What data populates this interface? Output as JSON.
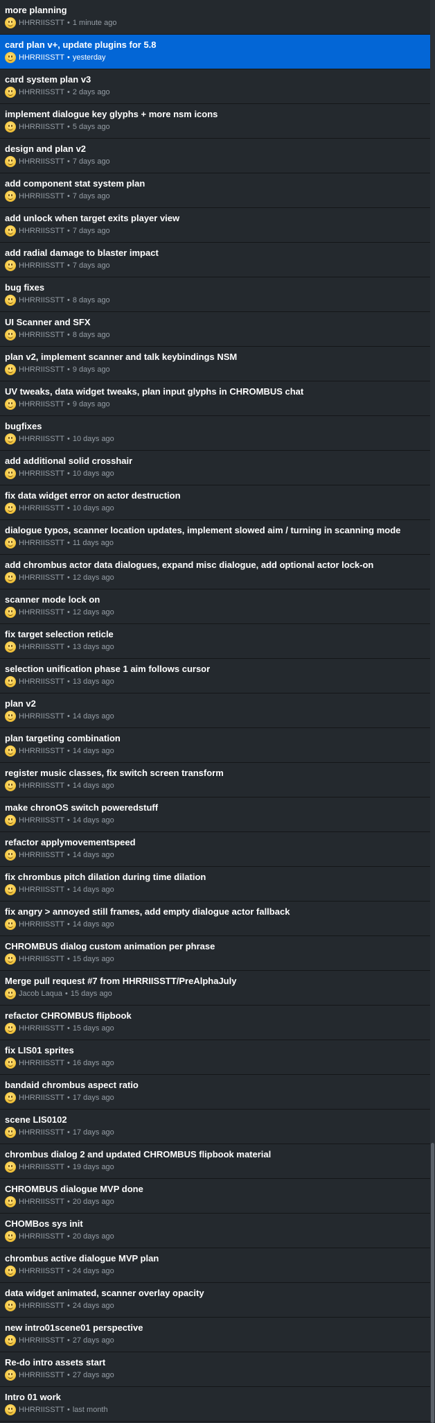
{
  "commits": [
    {
      "summary": "more planning",
      "author": "HHRRIISSTT",
      "time": "1 minute ago"
    },
    {
      "summary": "card plan v+, update plugins for 5.8",
      "author": "HHRRIISSTT",
      "time": "yesterday",
      "selected": true
    },
    {
      "summary": "card system plan v3",
      "author": "HHRRIISSTT",
      "time": "2 days ago"
    },
    {
      "summary": "implement dialogue key glyphs + more nsm icons",
      "author": "HHRRIISSTT",
      "time": "5 days ago"
    },
    {
      "summary": "design and plan v2",
      "author": "HHRRIISSTT",
      "time": "7 days ago"
    },
    {
      "summary": "add component stat system plan",
      "author": "HHRRIISSTT",
      "time": "7 days ago"
    },
    {
      "summary": "add unlock when target exits player view",
      "author": "HHRRIISSTT",
      "time": "7 days ago"
    },
    {
      "summary": "add radial damage to blaster impact",
      "author": "HHRRIISSTT",
      "time": "7 days ago"
    },
    {
      "summary": "bug fixes",
      "author": "HHRRIISSTT",
      "time": "8 days ago"
    },
    {
      "summary": "UI Scanner and SFX",
      "author": "HHRRIISSTT",
      "time": "8 days ago"
    },
    {
      "summary": "plan v2, implement scanner and talk keybindings NSM",
      "author": "HHRRIISSTT",
      "time": "9 days ago"
    },
    {
      "summary": "UV tweaks, data widget tweaks, plan input glyphs in CHROMBUS chat",
      "author": "HHRRIISSTT",
      "time": "9 days ago"
    },
    {
      "summary": "bugfixes",
      "author": "HHRRIISSTT",
      "time": "10 days ago"
    },
    {
      "summary": "add additional solid crosshair",
      "author": "HHRRIISSTT",
      "time": "10 days ago"
    },
    {
      "summary": "fix data widget error on actor destruction",
      "author": "HHRRIISSTT",
      "time": "10 days ago"
    },
    {
      "summary": "dialogue typos, scanner location updates, implement slowed aim / turning in scanning mode",
      "author": "HHRRIISSTT",
      "time": "11 days ago"
    },
    {
      "summary": "add chrombus actor data dialogues, expand misc dialogue, add optional actor lock-on",
      "author": "HHRRIISSTT",
      "time": "12 days ago"
    },
    {
      "summary": "scanner mode lock on",
      "author": "HHRRIISSTT",
      "time": "12 days ago"
    },
    {
      "summary": "fix target selection reticle",
      "author": "HHRRIISSTT",
      "time": "13 days ago"
    },
    {
      "summary": "selection unification phase 1 aim follows cursor",
      "author": "HHRRIISSTT",
      "time": "13 days ago"
    },
    {
      "summary": "plan v2",
      "author": "HHRRIISSTT",
      "time": "14 days ago"
    },
    {
      "summary": "plan targeting combination",
      "author": "HHRRIISSTT",
      "time": "14 days ago"
    },
    {
      "summary": "register music classes, fix switch screen transform",
      "author": "HHRRIISSTT",
      "time": "14 days ago"
    },
    {
      "summary": "make chronOS switch poweredstuff",
      "author": "HHRRIISSTT",
      "time": "14 days ago"
    },
    {
      "summary": "refactor applymovementspeed",
      "author": "HHRRIISSTT",
      "time": "14 days ago"
    },
    {
      "summary": "fix chrombus pitch dilation during time dilation",
      "author": "HHRRIISSTT",
      "time": "14 days ago"
    },
    {
      "summary": "fix angry > annoyed still frames, add empty dialogue actor fallback",
      "author": "HHRRIISSTT",
      "time": "14 days ago"
    },
    {
      "summary": "CHROMBUS dialog custom animation per phrase",
      "author": "HHRRIISSTT",
      "time": "15 days ago"
    },
    {
      "summary": "Merge pull request #7 from HHRRIISSTT/PreAlphaJuly",
      "author": "Jacob Laqua",
      "time": "15 days ago"
    },
    {
      "summary": "refactor CHROMBUS flipbook",
      "author": "HHRRIISSTT",
      "time": "15 days ago"
    },
    {
      "summary": "fix LIS01 sprites",
      "author": "HHRRIISSTT",
      "time": "16 days ago"
    },
    {
      "summary": "bandaid chrombus aspect ratio",
      "author": "HHRRIISSTT",
      "time": "17 days ago"
    },
    {
      "summary": "scene LIS0102",
      "author": "HHRRIISSTT",
      "time": "17 days ago"
    },
    {
      "summary": "chrombus dialog 2 and updated CHROMBUS flipbook material",
      "author": "HHRRIISSTT",
      "time": "19 days ago"
    },
    {
      "summary": "CHROMBUS dialogue MVP done",
      "author": "HHRRIISSTT",
      "time": "20 days ago"
    },
    {
      "summary": "CHOMBos sys init",
      "author": "HHRRIISSTT",
      "time": "20 days ago"
    },
    {
      "summary": "chrombus active dialogue MVP plan",
      "author": "HHRRIISSTT",
      "time": "24 days ago"
    },
    {
      "summary": "data widget animated, scanner overlay opacity",
      "author": "HHRRIISSTT",
      "time": "24 days ago"
    },
    {
      "summary": "new intro01scene01 perspective",
      "author": "HHRRIISSTT",
      "time": "27 days ago"
    },
    {
      "summary": "Re-do intro assets start",
      "author": "HHRRIISSTT",
      "time": "27 days ago"
    },
    {
      "summary": "Intro 01 work",
      "author": "HHRRIISSTT",
      "time": "last month"
    }
  ],
  "separator": "•",
  "colors": {
    "background": "#24292e",
    "selected": "#0366d6",
    "text": "#ffffff",
    "meta": "#959da5"
  },
  "icons": {
    "avatar": "smiley-avatar-icon"
  }
}
